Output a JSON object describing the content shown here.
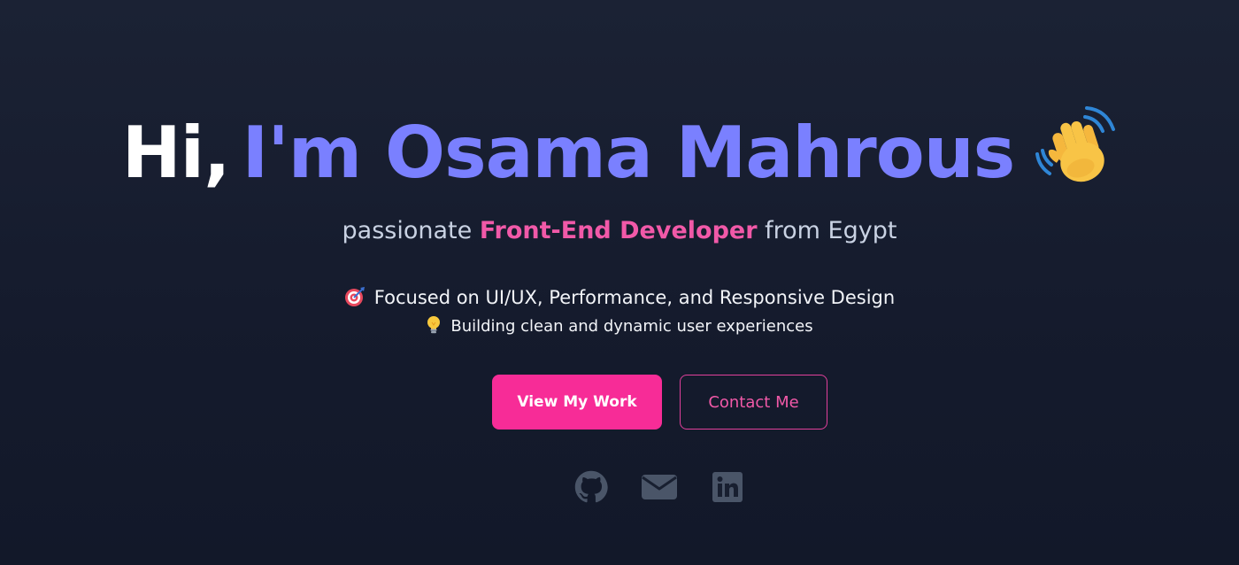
{
  "hero": {
    "greeting": "Hi,",
    "name": "I'm Osama Mahrous",
    "subtitle_prefix": "passionate ",
    "subtitle_role": "Front-End Developer",
    "subtitle_suffix": " from Egypt",
    "focus_text": "Focused on UI/UX, Performance, and Responsive Design",
    "building_text": "Building clean and dynamic user experiences"
  },
  "buttons": {
    "primary_label": "View My Work",
    "secondary_label": "Contact Me"
  },
  "social": [
    {
      "name": "github",
      "icon": "github-icon"
    },
    {
      "name": "email",
      "icon": "envelope-icon"
    },
    {
      "name": "linkedin",
      "icon": "linkedin-icon"
    }
  ],
  "icons": {
    "wave": "waving-hand-icon",
    "focus": "target-icon",
    "building": "lightbulb-icon"
  },
  "colors": {
    "background": "#181f30",
    "name": "#7a80ff",
    "accent": "#f72c97",
    "role": "#f159a8",
    "social_icon": "#4a5568"
  }
}
